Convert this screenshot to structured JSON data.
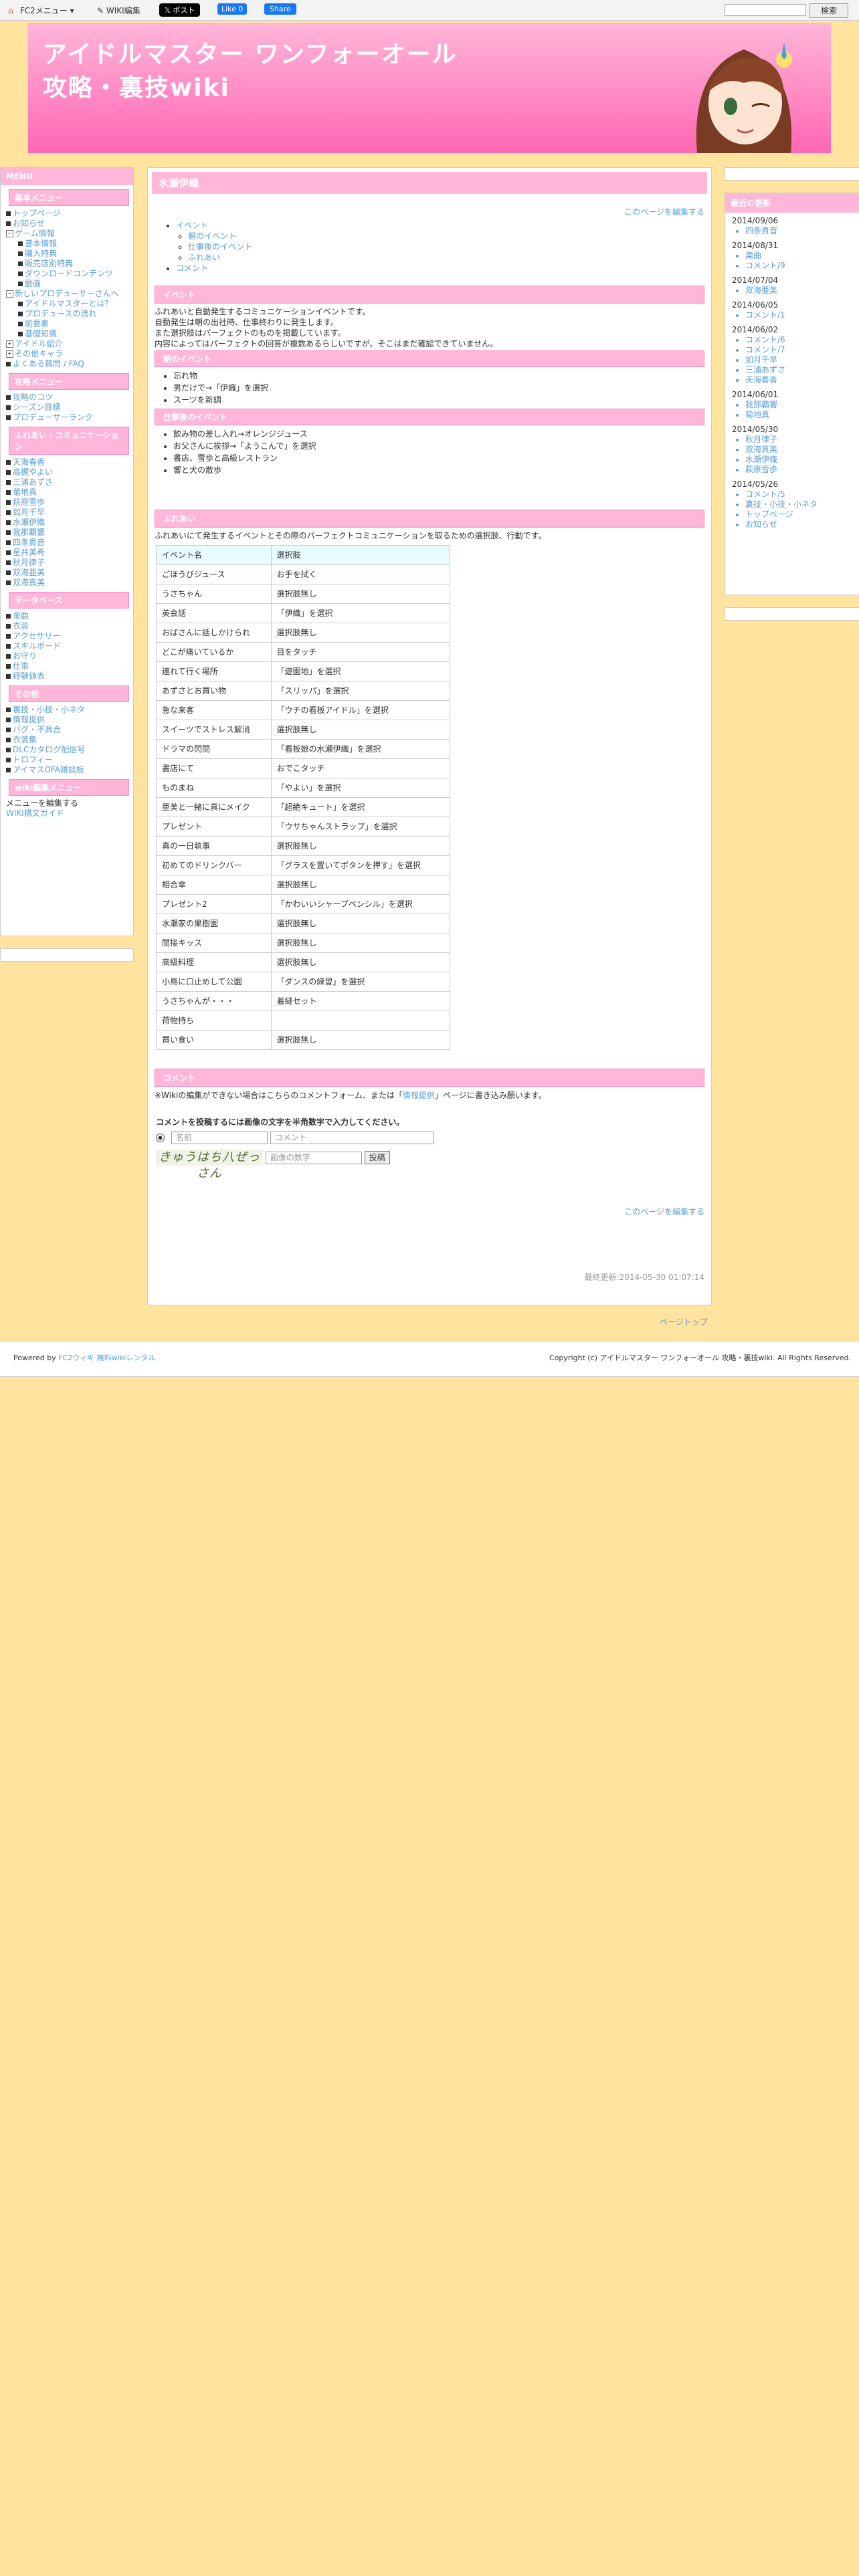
{
  "topbar": {
    "fc2_menu": "FC2メニュー",
    "wiki_edit": "WIKI編集",
    "post": "ポスト",
    "like": "Like 0",
    "share": "Share",
    "search_button": "検索"
  },
  "header": {
    "title_line1": "アイドルマスター ワンフォーオール",
    "title_line2": "攻略・裏技wiki"
  },
  "sidebar": {
    "title": "MENU",
    "basic_menu": "基本メニュー",
    "basic_items": [
      {
        "label": "トップページ",
        "mark": "■",
        "indent": false
      },
      {
        "label": "お知らせ",
        "mark": "■",
        "indent": false
      },
      {
        "label": "ゲーム情報",
        "mark": "−",
        "indent": false
      },
      {
        "label": "基本情報",
        "mark": "■",
        "indent": true
      },
      {
        "label": "購入特典",
        "mark": "■",
        "indent": true
      },
      {
        "label": "販売店別特典",
        "mark": "■",
        "indent": true
      },
      {
        "label": "ダウンロードコンテンツ",
        "mark": "■",
        "indent": true
      },
      {
        "label": "動画",
        "mark": "■",
        "indent": true
      },
      {
        "label": "新しいプロデューサーさんへ",
        "mark": "−",
        "indent": false
      },
      {
        "label": "アイドルマスターとは？",
        "mark": "■",
        "indent": true
      },
      {
        "label": "プロデュースの流れ",
        "mark": "■",
        "indent": true
      },
      {
        "label": "前要素",
        "mark": "■",
        "indent": true
      },
      {
        "label": "基礎知識",
        "mark": "■",
        "indent": true
      },
      {
        "label": "アイドル紹介",
        "mark": "+",
        "indent": false
      },
      {
        "label": "その他キャラ",
        "mark": "+",
        "indent": false
      },
      {
        "label": "よくある質問 / FAQ",
        "mark": "■",
        "indent": false
      }
    ],
    "strategy_menu": "攻略メニュー",
    "strategy_items": [
      "攻略のコツ",
      "シーズン目標",
      "プロデューサーランク"
    ],
    "fureai_menu": "ふれあい・コミュニケーション",
    "fureai_items": [
      "天海春香",
      "高槻やよい",
      "三浦あずさ",
      "菊地真",
      "萩原雪歩",
      "如月千早",
      "水瀬伊織",
      "我那覇響",
      "四条貴音",
      "星井美希",
      "秋月律子",
      "双海亜美",
      "双海真美"
    ],
    "database_menu": "データベース",
    "database_items": [
      "楽曲",
      "衣装",
      "アクセサリー",
      "スキルボード",
      "お守り",
      "仕事",
      "経験値表"
    ],
    "other_menu": "その他",
    "other_items": [
      "裏技・小技・小ネタ",
      "情報提供",
      "バグ・不具合",
      "衣装集",
      "DLCカタログ配信号",
      "トロフィー",
      "アイマスOFA雑談板"
    ],
    "wiki_edit_menu": "wiki編集メニュー",
    "wiki_edit_items": [
      "メニューを編集する",
      "WIKI構文ガイド"
    ]
  },
  "updates": {
    "title": "最近の更新",
    "groups": [
      {
        "date": "2014/09/06",
        "items": [
          "四条貴音"
        ]
      },
      {
        "date": "2014/08/31",
        "items": [
          "楽曲",
          "コメント/9"
        ]
      },
      {
        "date": "2014/07/04",
        "items": [
          "双海亜美"
        ]
      },
      {
        "date": "2014/06/05",
        "items": [
          "コメント/1"
        ]
      },
      {
        "date": "2014/06/02",
        "items": [
          "コメント/6",
          "コメント/7",
          "如月千早",
          "三浦あずさ",
          "天海春香"
        ]
      },
      {
        "date": "2014/06/01",
        "items": [
          "我那覇響",
          "菊地真"
        ]
      },
      {
        "date": "2014/05/30",
        "items": [
          "秋月律子",
          "双海真美",
          "水瀬伊織",
          "萩原雪歩"
        ]
      },
      {
        "date": "2014/05/26",
        "items": [
          "コメント/5",
          "裏技・小技・小ネタ",
          "トップページ",
          "お知らせ"
        ]
      }
    ]
  },
  "main": {
    "page_title": "水瀬伊織",
    "edit_link": "このページを編集する",
    "toc": {
      "event": "イベント",
      "morning": "朝のイベント",
      "after_work": "仕事後のイベント",
      "fureai": "ふれあい",
      "comment": "コメント"
    },
    "event_heading": "イベント",
    "event_text": [
      "ふれあいと自動発生するコミュニケーションイベントです。",
      "自動発生は朝の出社時、仕事終わりに発生します。",
      "また選択肢はパーフェクトのものを掲載しています。",
      "内容によってはパーフェクトの回答が複数あるらしいですが、そこはまだ確認できていません。"
    ],
    "morning_heading": "朝のイベント",
    "morning_items": [
      "忘れ物",
      "男だけで→「伊織」を選択",
      "スーツを新調"
    ],
    "after_heading": "仕事後のイベント",
    "after_items": [
      "飲み物の差し入れ→オレンジジュース",
      "お父さんに挨拶→「ようこんで」を選択",
      "書店、雪歩と高級レストラン",
      "響と犬の散歩"
    ],
    "fureai_heading": "ふれあい",
    "fureai_text": "ふれあいにて発生するイベントとその際のパーフェクトコミュニケーションを取るための選択肢、行動です。",
    "table_header": {
      "event": "イベント名",
      "choice": "選択肢"
    },
    "table_rows": [
      {
        "event": "ごほうびジュース",
        "choice": "お手を拭く"
      },
      {
        "event": "うさちゃん",
        "choice": "選択肢無し"
      },
      {
        "event": "英会話",
        "choice": "「伊織」を選択"
      },
      {
        "event": "おばさんに話しかけられ",
        "choice": "選択肢無し"
      },
      {
        "event": "どこが痛いているか",
        "choice": "目をタッチ"
      },
      {
        "event": "連れて行く場所",
        "choice": "「遊園地」を選択"
      },
      {
        "event": "あずさとお買い物",
        "choice": "「スリッパ」を選択"
      },
      {
        "event": "急な来客",
        "choice": "「ウチの看板アイドル」を選択"
      },
      {
        "event": "スイーツでストレス解消",
        "choice": "選択肢無し"
      },
      {
        "event": "ドラマの閃問",
        "choice": "「看板娘の水瀬伊織」を選択"
      },
      {
        "event": "書店にて",
        "choice": "おでこタッチ"
      },
      {
        "event": "ものまね",
        "choice": "「やよい」を選択"
      },
      {
        "event": "亜美と一緒に真にメイク",
        "choice": "「超絶キュート」を選択"
      },
      {
        "event": "プレゼント",
        "choice": "「ウサちゃんストラップ」を選択"
      },
      {
        "event": "真の一日執事",
        "choice": "選択肢無し"
      },
      {
        "event": "初めてのドリンクバー",
        "choice": "「グラスを置いてボタンを押す」を選択"
      },
      {
        "event": "相合傘",
        "choice": "選択肢無し"
      },
      {
        "event": "プレゼント2",
        "choice": "「かわいいシャープペンシル」を選択"
      },
      {
        "event": "水瀬家の果樹園",
        "choice": "選択肢無し"
      },
      {
        "event": "間接キッス",
        "choice": "選択肢無し"
      },
      {
        "event": "高級料理",
        "choice": "選択肢無し"
      },
      {
        "event": "小鳥に口止めして公園",
        "choice": "「ダンスの練習」を選択"
      },
      {
        "event": "うさちゃんが・・・",
        "choice": "着縫セット"
      },
      {
        "event": "荷物持ち",
        "choice": ""
      },
      {
        "event": "買い食い",
        "choice": "選択肢無し"
      }
    ],
    "comment_heading": "コメント",
    "comment_note_pre": "※Wikiの編集ができない場合はこちらのコメントフォーム、または「",
    "comment_note_link": "情報提供",
    "comment_note_post": "」ページに書き込み願います。",
    "form_instruction": "コメントを投稿するには画像の文字を半角数字で入力してください。",
    "name_placeholder": "名前",
    "comment_placeholder": "コメント",
    "captcha_text": "きゅうはち八ぜっさん",
    "captcha_placeholder": "画像の数字",
    "submit": "投稿",
    "edit_link_bottom": "このページを編集する",
    "last_modified": "最終更新:2014-05-30 01:07:14"
  },
  "page_top": "ページトップ",
  "footer": {
    "powered_by": "Powered by",
    "fc2": "FC2ウィキ",
    "rental": "無料wikiレンタル",
    "copyright": "Copyright (c) アイドルマスター ワンフォーオール 攻略・裏技wiki. All Rights Reserved."
  },
  "colors": {
    "accent": "#ffb6d9",
    "background": "#ffe39e",
    "link": "#5a9ed6",
    "table_header": "#e8fbff"
  }
}
